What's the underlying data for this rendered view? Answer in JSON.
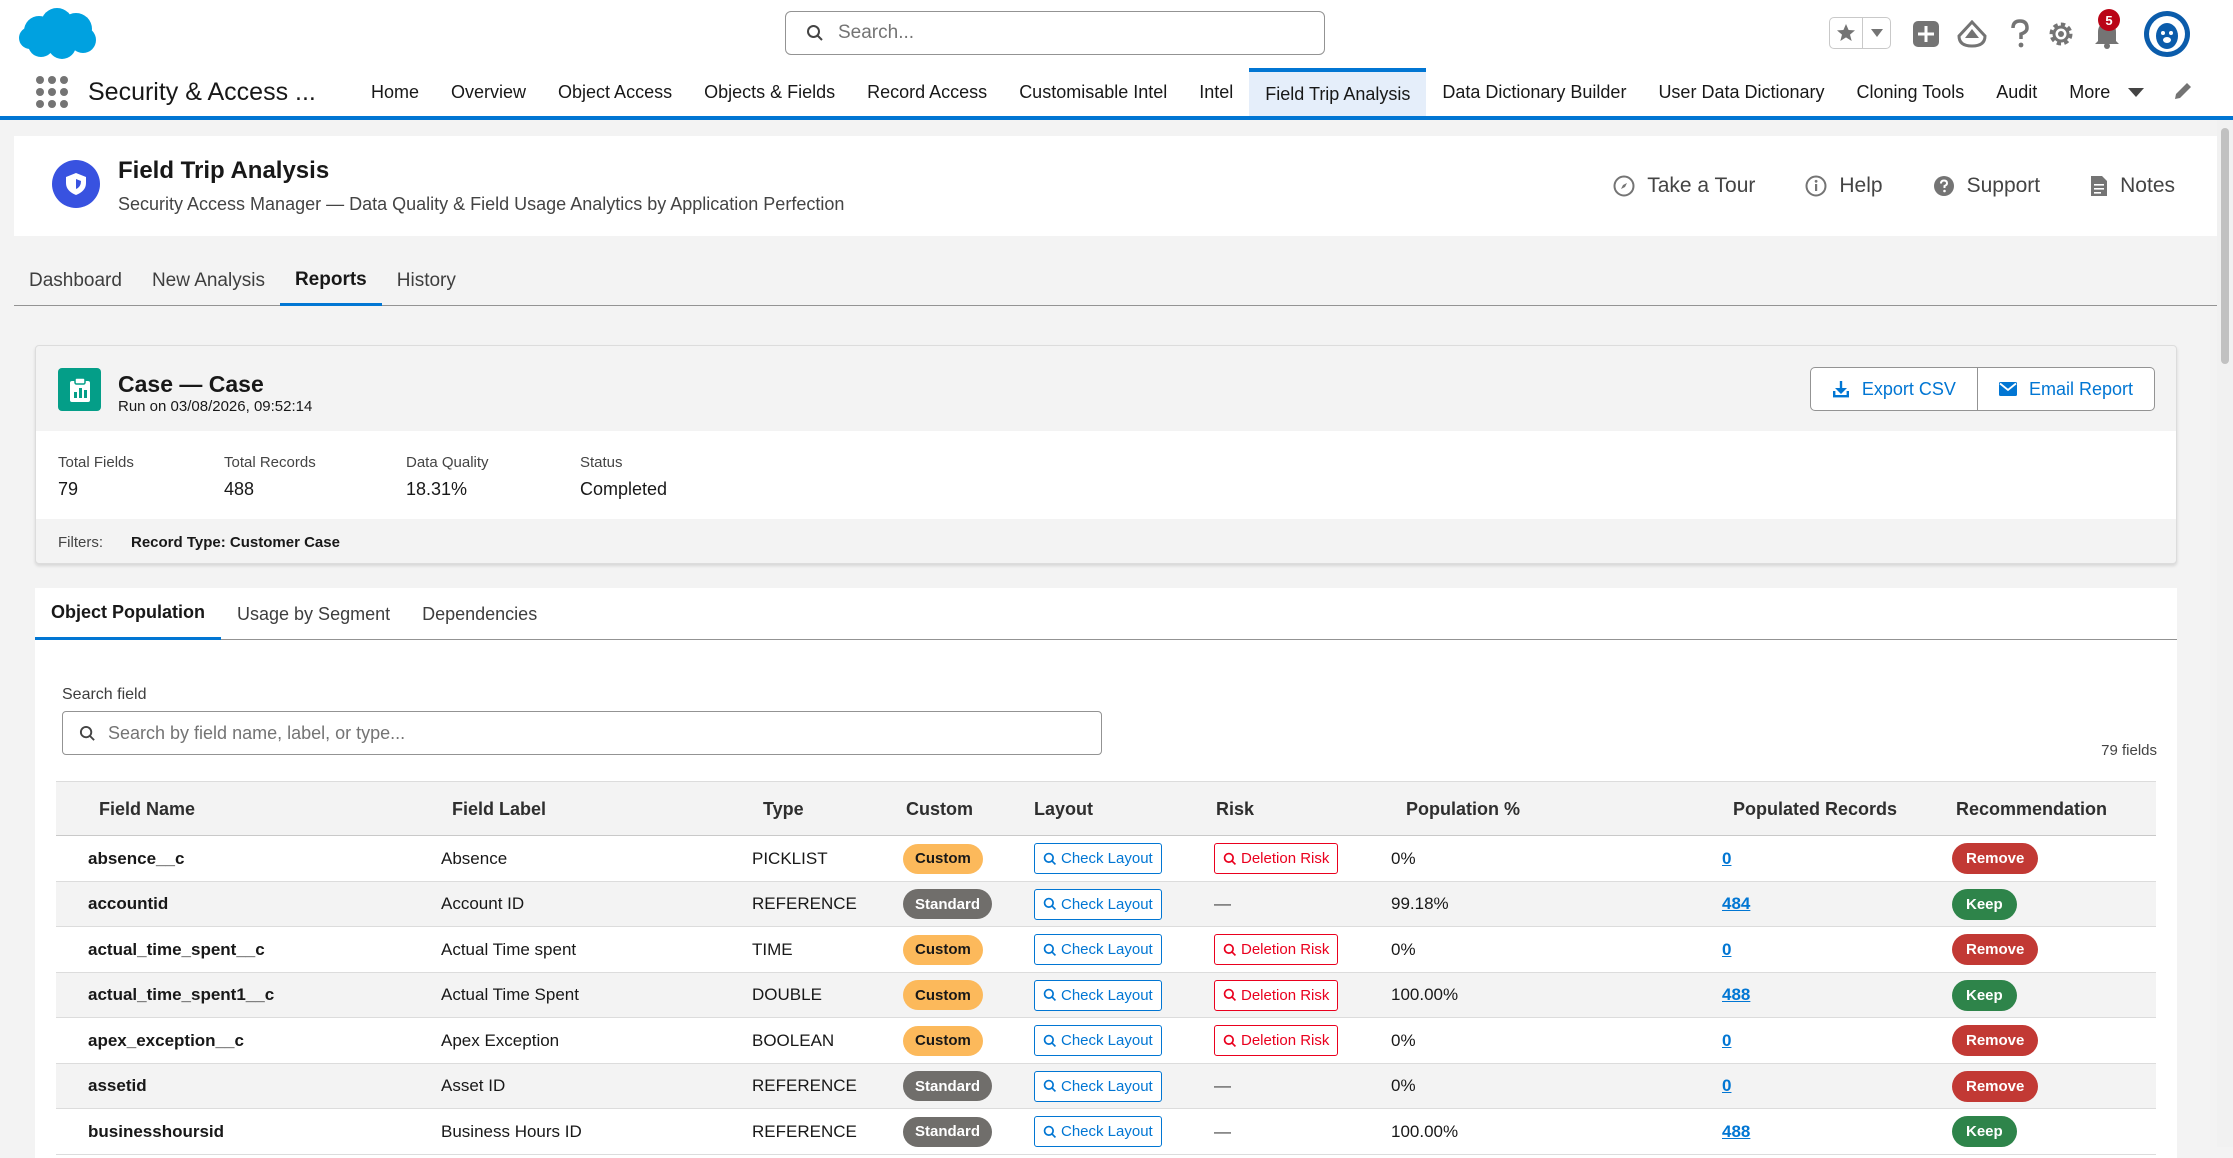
{
  "header": {
    "search_placeholder": "Search...",
    "notification_count": "5"
  },
  "nav": {
    "app_name": "Security & Access ...",
    "items": [
      "Home",
      "Overview",
      "Object Access",
      "Objects & Fields",
      "Record Access",
      "Customisable Intel",
      "Intel",
      "Field Trip Analysis",
      "Data Dictionary Builder",
      "User Data Dictionary",
      "Cloning Tools",
      "Audit",
      "More"
    ],
    "active": "Field Trip Analysis"
  },
  "page_header": {
    "title": "Field Trip Analysis",
    "subtitle": "Security Access Manager — Data Quality & Field Usage Analytics by Application Perfection",
    "actions": [
      {
        "label": "Take a Tour",
        "icon": "compass-icon"
      },
      {
        "label": "Help",
        "icon": "info-icon"
      },
      {
        "label": "Support",
        "icon": "question-icon"
      },
      {
        "label": "Notes",
        "icon": "note-icon"
      }
    ]
  },
  "page_tabs": {
    "items": [
      "Dashboard",
      "New Analysis",
      "Reports",
      "History"
    ],
    "active": "Reports"
  },
  "report": {
    "title": "Case — Case",
    "run_on": "Run on 03/08/2026, 09:52:14",
    "export_label": "Export CSV",
    "email_label": "Email Report",
    "stats": [
      {
        "label": "Total Fields",
        "value": "79"
      },
      {
        "label": "Total Records",
        "value": "488"
      },
      {
        "label": "Data Quality",
        "value": "18.31%"
      },
      {
        "label": "Status",
        "value": "Completed"
      }
    ],
    "filters_label": "Filters:",
    "filter_value": "Record Type: Customer Case"
  },
  "inner_tabs": {
    "items": [
      "Object Population",
      "Usage by Segment",
      "Dependencies"
    ],
    "active": "Object Population"
  },
  "search_field": {
    "label": "Search field",
    "placeholder": "Search by field name, label, or type...",
    "count": "79 fields"
  },
  "table": {
    "columns": [
      "Field Name",
      "Field Label",
      "Type",
      "Custom",
      "Layout",
      "Risk",
      "Population %",
      "Populated Records",
      "Recommendation"
    ],
    "rows": [
      {
        "name": "absence__c",
        "label": "Absence",
        "type": "PICKLIST",
        "custom": "Custom",
        "layout": "Check Layout",
        "risk": "Deletion Risk",
        "pct": "0%",
        "pct_value": 0,
        "records": "0",
        "rec": "Remove"
      },
      {
        "name": "accountid",
        "label": "Account ID",
        "type": "REFERENCE",
        "custom": "Standard",
        "layout": "Check Layout",
        "risk": "—",
        "pct": "99.18%",
        "pct_value": 99.18,
        "records": "484",
        "rec": "Keep"
      },
      {
        "name": "actual_time_spent__c",
        "label": "Actual Time spent",
        "type": "TIME",
        "custom": "Custom",
        "layout": "Check Layout",
        "risk": "Deletion Risk",
        "pct": "0%",
        "pct_value": 0,
        "records": "0",
        "rec": "Remove"
      },
      {
        "name": "actual_time_spent1__c",
        "label": "Actual Time Spent",
        "type": "DOUBLE",
        "custom": "Custom",
        "layout": "Check Layout",
        "risk": "Deletion Risk",
        "pct": "100.00%",
        "pct_value": 100,
        "records": "488",
        "rec": "Keep"
      },
      {
        "name": "apex_exception__c",
        "label": "Apex Exception",
        "type": "BOOLEAN",
        "custom": "Custom",
        "layout": "Check Layout",
        "risk": "Deletion Risk",
        "pct": "0%",
        "pct_value": 0,
        "records": "0",
        "rec": "Remove"
      },
      {
        "name": "assetid",
        "label": "Asset ID",
        "type": "REFERENCE",
        "custom": "Standard",
        "layout": "Check Layout",
        "risk": "—",
        "pct": "0%",
        "pct_value": 0,
        "records": "0",
        "rec": "Remove"
      },
      {
        "name": "businesshoursid",
        "label": "Business Hours ID",
        "type": "REFERENCE",
        "custom": "Standard",
        "layout": "Check Layout",
        "risk": "—",
        "pct": "100.00%",
        "pct_value": 100,
        "records": "488",
        "rec": "Keep"
      }
    ]
  },
  "colors": {
    "brand": "#0176d3",
    "custom_badge": "#fcb95b",
    "standard_badge": "#706e6b",
    "remove": "#c23934",
    "keep": "#2e844a",
    "risk": "#ea001e"
  }
}
